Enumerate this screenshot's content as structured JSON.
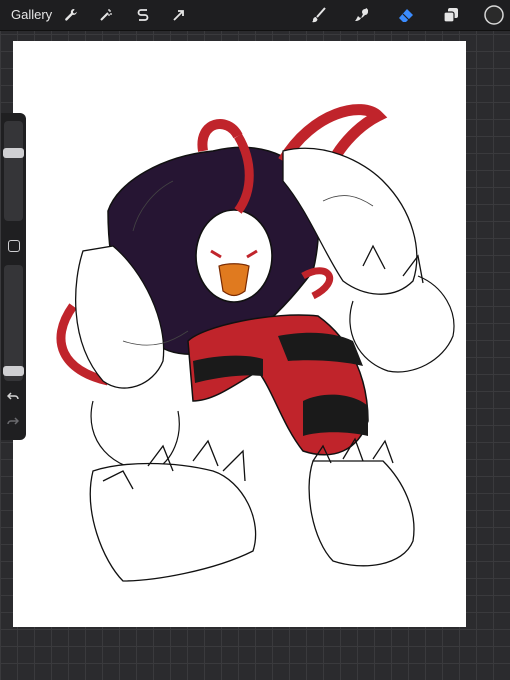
{
  "topbar": {
    "gallery_label": "Gallery",
    "left_tools": [
      "wrench-icon",
      "magic-wand-icon",
      "selection-s-icon",
      "move-arrow-icon"
    ],
    "right_tools": [
      "brush-icon",
      "smudge-icon",
      "eraser-icon",
      "layers-icon",
      "color-swatch-icon"
    ],
    "active_tool": "eraser-icon",
    "active_color": "#2a2a2a",
    "accent": "#3b8cff"
  },
  "sidebar": {
    "brush_size_level": 0.7,
    "opacity_level": 0.05,
    "modify_button": "square-modify-icon",
    "undo_icon": "undo-icon",
    "redo_icon": "redo-icon"
  },
  "artwork": {
    "subject": "sketch",
    "palette": {
      "purple": "#261533",
      "red": "#c0242b",
      "black": "#1a1a1a",
      "orange": "#e07a1f"
    }
  }
}
